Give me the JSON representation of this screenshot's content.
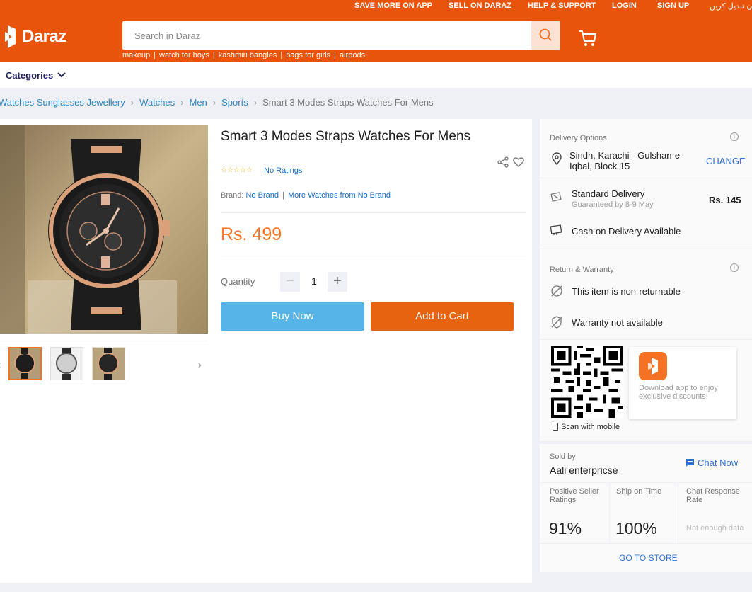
{
  "header": {
    "top_links": [
      "SAVE MORE ON APP",
      "SELL ON DARAZ",
      "HELP & SUPPORT",
      "LOGIN",
      "SIGN UP",
      "زبان تبدیل کریں"
    ],
    "logo_text": "Daraz",
    "search_placeholder": "Search in Daraz",
    "suggestions": [
      "makeup",
      "watch for boys",
      "kashmiri bangles",
      "bags for girls",
      "airpods"
    ],
    "brand_color": "#e8540c"
  },
  "categories_label": "Categories",
  "breadcrumb": [
    "Watches Sunglasses Jewellery",
    "Watches",
    "Men",
    "Sports",
    "Smart 3 Modes Straps Watches For Mens"
  ],
  "product": {
    "title": "Smart 3 Modes Straps Watches For Mens",
    "stars": "☆☆☆☆☆",
    "ratings_text": "No Ratings",
    "brand_label": "Brand:",
    "brand_value": "No Brand",
    "brand_more": "More Watches from No Brand",
    "price": "Rs. 499",
    "quantity_label": "Quantity",
    "quantity": "1",
    "minus": "−",
    "plus": "+",
    "buy_now": "Buy Now",
    "add_to_cart": "Add to Cart"
  },
  "delivery": {
    "heading": "Delivery Options",
    "location": "Sindh, Karachi - Gulshan-e-Iqbal, Block 15",
    "change": "CHANGE",
    "standard": "Standard Delivery",
    "guarantee": "Guaranteed by 8-9 May",
    "fee": "Rs. 145",
    "cod": "Cash on Delivery Available"
  },
  "return": {
    "heading": "Return & Warranty",
    "returnable": "This item is non-returnable",
    "warranty": "Warranty not available"
  },
  "app": {
    "scan": "Scan with mobile",
    "promo": "Download app to enjoy exclusive discounts!"
  },
  "seller": {
    "label": "Sold by",
    "name": "Aali enterpricse",
    "chat": "Chat Now",
    "stats": [
      {
        "label": "Positive Seller Ratings",
        "value": "91%"
      },
      {
        "label": "Ship on Time",
        "value": "100%"
      },
      {
        "label": "Chat Response Rate",
        "value": "Not enough data"
      }
    ],
    "go_store": "GO TO STORE"
  }
}
